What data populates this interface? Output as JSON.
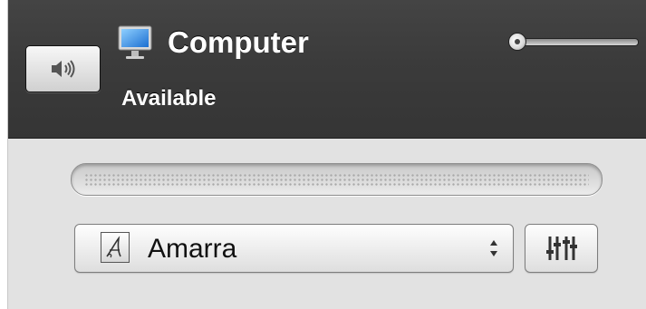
{
  "device": {
    "name": "Computer",
    "status": "Available",
    "icon": "monitor-icon"
  },
  "volume": {
    "level": 0.0,
    "mute_button_icon": "speaker-icon"
  },
  "playback": {
    "progress": 0.0
  },
  "player": {
    "selected": "Amarra",
    "icon": "amarra-logo-icon"
  },
  "controls": {
    "settings_icon": "equalizer-sliders-icon"
  }
}
